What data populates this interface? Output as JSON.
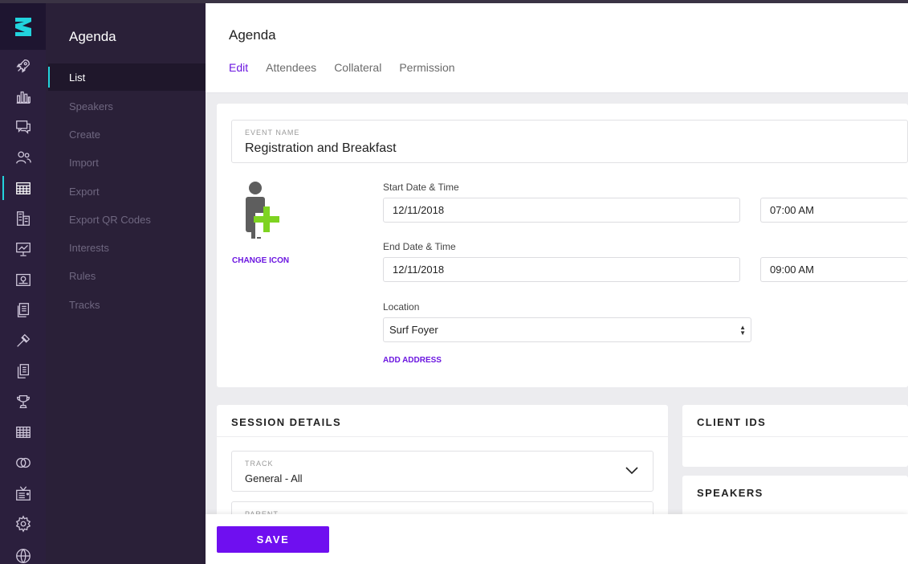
{
  "sidebar": {
    "title": "Agenda",
    "items": [
      {
        "label": "List"
      },
      {
        "label": "Speakers"
      },
      {
        "label": "Create"
      },
      {
        "label": "Import"
      },
      {
        "label": "Export"
      },
      {
        "label": "Export QR Codes"
      },
      {
        "label": "Interests"
      },
      {
        "label": "Rules"
      },
      {
        "label": "Tracks"
      }
    ]
  },
  "rail": {
    "logo": "z-logo-icon",
    "icons": [
      "rocket-icon",
      "bar-chart-icon",
      "chat-icon",
      "users-icon",
      "agenda-table-icon",
      "buildings-icon",
      "presentation-icon",
      "map-icon",
      "documents-icon",
      "tools-icon",
      "copy-icon",
      "trophy-icon",
      "grid-icon",
      "rings-icon",
      "tv-icon",
      "gear-icon",
      "globe-icon"
    ],
    "active_icon": "agenda-table-icon"
  },
  "header": {
    "title": "Agenda",
    "tabs": [
      {
        "label": "Edit"
      },
      {
        "label": "Attendees"
      },
      {
        "label": "Collateral"
      },
      {
        "label": "Permission"
      }
    ],
    "active_tab": "Edit"
  },
  "event": {
    "name_caption": "EVENT NAME",
    "name_value": "Registration and Breakfast",
    "change_icon_label": "CHANGE ICON",
    "start_label": "Start Date & Time",
    "start_date": "12/11/2018",
    "start_time": "07:00 AM",
    "end_label": "End Date & Time",
    "end_date": "12/11/2018",
    "end_time": "09:00 AM",
    "location_label": "Location",
    "location_value": "Surf Foyer",
    "add_address_label": "ADD ADDRESS"
  },
  "session": {
    "title": "SESSION DETAILS",
    "track_caption": "TRACK",
    "track_value": "General - All",
    "parent_caption": "PARENT"
  },
  "client_ids": {
    "title": "CLIENT IDS"
  },
  "speakers": {
    "title": "SPEAKERS"
  },
  "footer": {
    "save_label": "SAVE"
  },
  "colors": {
    "accent": "#6f0ff0",
    "rail_bg": "#2b1f3d",
    "active_indicator": "#22d3dd",
    "icon_plus": "#7ed321"
  }
}
